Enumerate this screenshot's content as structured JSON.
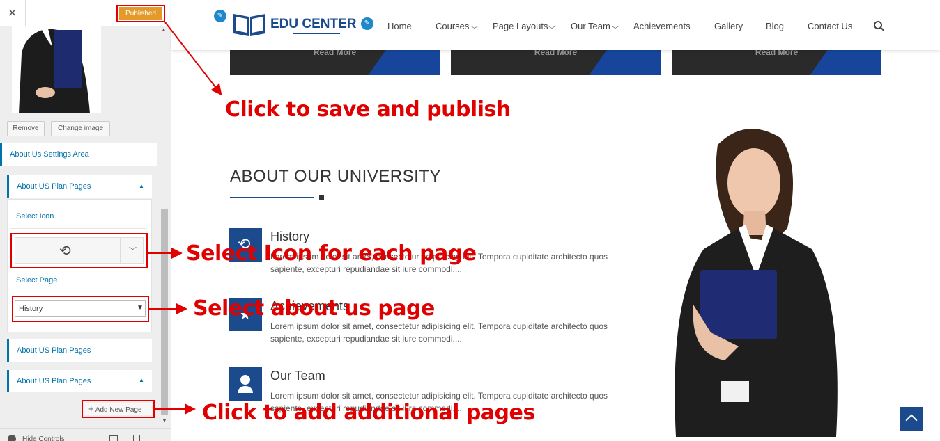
{
  "panel": {
    "published_label": "Published",
    "remove_label": "Remove",
    "change_image_label": "Change image",
    "settings_area_label": "About Us Settings Area",
    "plan_pages_label": "About US Plan Pages",
    "select_icon_label": "Select Icon",
    "select_page_label": "Select Page",
    "selected_page": "History",
    "add_new_page_label": "Add New Page",
    "hide_controls_label": "Hide Controls"
  },
  "site": {
    "logo_text": "EDU CENTER",
    "nav": [
      "Home",
      "Courses",
      "Page Layouts",
      "Our Team",
      "Achievements",
      "Gallery",
      "Blog",
      "Contact Us"
    ],
    "read_more": "Read More",
    "section_title": "ABOUT OUR UNIVERSITY",
    "items": [
      {
        "title": "History",
        "text_line1": "Lorem ipsum dolor sit amet, consectetur adipisicing elit. Tempora cupiditate architecto quos",
        "text_line2": "sapiente, excepturi repudiandae sit iure commodi...."
      },
      {
        "title": "Achievements",
        "text_line1": "Lorem ipsum dolor sit amet, consectetur adipisicing elit. Tempora cupiditate architecto quos",
        "text_line2": "sapiente, excepturi repudiandae sit iure commodi...."
      },
      {
        "title": "Our Team",
        "text_line1": "Lorem ipsum dolor sit amet, consectetur adipisicing elit. Tempora cupiditate architecto quos",
        "text_line2": "sapiente, excepturi repudiandae sit iure commodi...."
      }
    ]
  },
  "annotations": {
    "save_publish": "Click to save and publish",
    "select_icon": "Select Icon for each page",
    "select_page": "Select about us page",
    "add_pages": "Click to add additional pages"
  },
  "colors": {
    "accent": "#0073aa",
    "annotation": "#e00000",
    "brand": "#1b4b8c",
    "publish": "#e49a2a"
  }
}
